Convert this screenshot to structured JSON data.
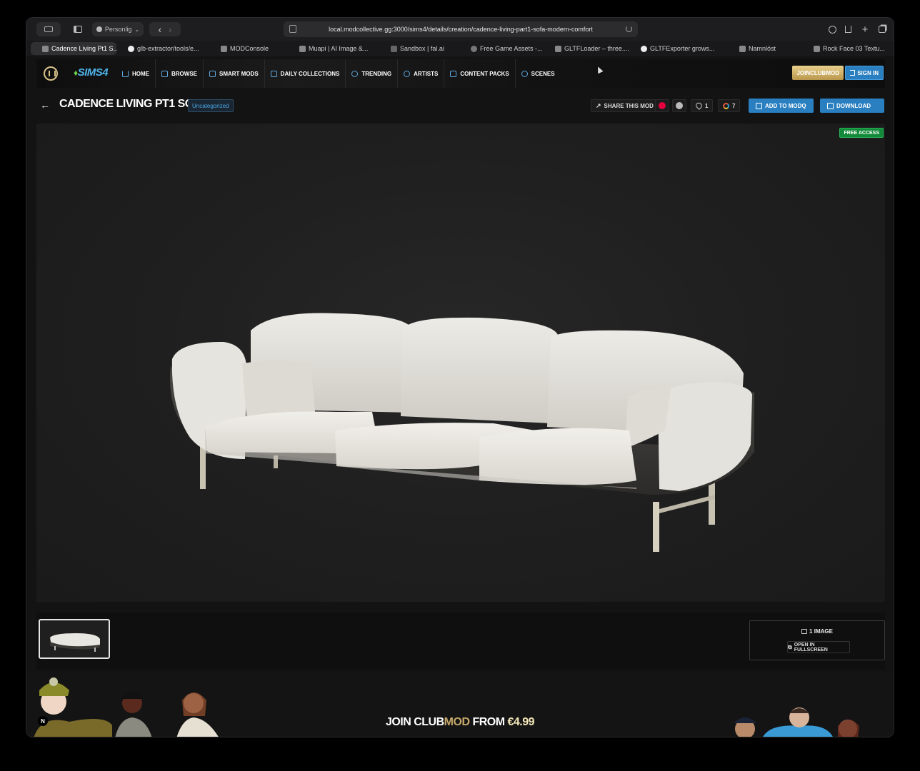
{
  "browser": {
    "profile_label": "Personlig",
    "url": "local.modcollective.gg:3000/sims4/details/creation/cadence-living-part1-sofa-modern-comfort",
    "tabs": [
      {
        "label": "Cadence Living Pt1 S...",
        "icon": "site-favicon",
        "active": true
      },
      {
        "label": "glb-extractor/tools/e...",
        "icon": "github-icon"
      },
      {
        "label": "MODConsole",
        "icon": "modconsole-icon"
      },
      {
        "label": "Muapi | AI Image &...",
        "icon": "muapi-icon"
      },
      {
        "label": "Sandbox | fal.ai",
        "icon": "fal-icon"
      },
      {
        "label": "Free Game Assets -...",
        "icon": "game-assets-icon"
      },
      {
        "label": "GLTFLoader – three....",
        "icon": "three-icon"
      },
      {
        "label": "GLTFExporter grows...",
        "icon": "github-icon"
      },
      {
        "label": "Namnlöst",
        "icon": "blank-icon"
      },
      {
        "label": "Rock Face 03 Textu...",
        "icon": "polyhaven-icon"
      }
    ]
  },
  "site": {
    "sims_logo": "SIMS4",
    "nav": [
      {
        "label": "HOME",
        "icon": "home-icon"
      },
      {
        "label": "BROWSE",
        "icon": "folder-icon"
      },
      {
        "label": "SMART MODS",
        "icon": "folder-icon"
      },
      {
        "label": "DAILY COLLECTIONS",
        "icon": "folder-icon"
      },
      {
        "label": "TRENDING",
        "icon": "flame-icon"
      },
      {
        "label": "ARTISTS",
        "icon": "users-icon"
      },
      {
        "label": "CONTENT PACKS",
        "icon": "box-icon"
      },
      {
        "label": "SCENES",
        "icon": "cube-icon"
      }
    ],
    "join_label": "JOINCLUBMOD",
    "signin_label": "SIGN IN"
  },
  "detail": {
    "title": "CADENCE LIVING PT1 SOFA",
    "category": "Uncategorized",
    "share_label": "SHARE THIS MOD",
    "likes": "1",
    "rating_count": "7",
    "add_label": "ADD TO MODQ",
    "download_label": "DOWNLOAD",
    "access_badge": "FREE ACCESS"
  },
  "gallery": {
    "image_count_label": "1 IMAGE",
    "fullscreen_label": "OPEN IN FULLSCREEN"
  },
  "banner": {
    "prefix": "JOIN CLUB",
    "brand": "MOD",
    "middle": " FROM ",
    "price": "€4.99",
    "n_badge": "N"
  },
  "colors": {
    "accent_blue": "#2a7fc0",
    "gold": "#c8a96a",
    "free_green": "#138a3a"
  }
}
